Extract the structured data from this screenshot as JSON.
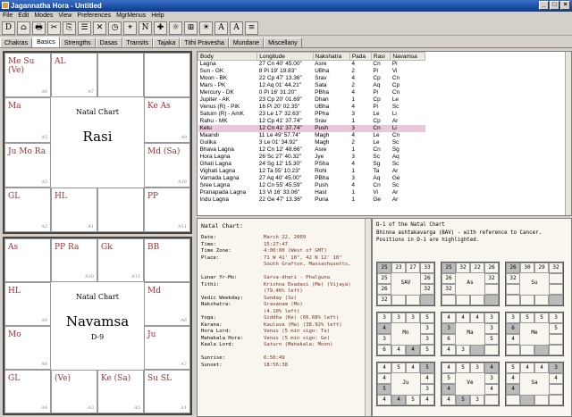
{
  "window": {
    "title": "Jagannatha Hora - Untitled",
    "buttons": [
      "_",
      "□",
      "×"
    ]
  },
  "menu": [
    "File",
    "Edit",
    "Modes",
    "View",
    "Preferences",
    "MgrMenus",
    "Help"
  ],
  "toolbar": [
    "D",
    "⌂",
    "🖶",
    "✂",
    "⎘",
    "☰",
    "✕",
    "◷",
    "⌖",
    "N",
    "✚",
    "☼",
    "⊞",
    "☀",
    "A",
    "A",
    "≡"
  ],
  "tabs": [
    "Chakras",
    "Basics",
    "Strengths",
    "Dasas",
    "Transits",
    "Tajaka",
    "Tithi Pravesha",
    "Mundane",
    "Miscellany"
  ],
  "active_tab": "Basics",
  "rasi": {
    "title": "Natal Chart",
    "name": "Rasi",
    "cells": [
      {
        "p": "Me  Su  (Ve)",
        "s": "A6"
      },
      {
        "p": "AL",
        "s": "A7"
      },
      {
        "p": "",
        "s": ""
      },
      {
        "p": "",
        "s": ""
      },
      {
        "p": "Ma",
        "s": "A5"
      },
      {
        "p": "Ke  As",
        "s": "A9"
      },
      {
        "p": "Ju  Mo  Ra",
        "s": "A3"
      },
      {
        "p": "Md  (Sa)",
        "s": "A10"
      },
      {
        "p": "GL",
        "s": "A2"
      },
      {
        "p": "HL",
        "s": "A1"
      },
      {
        "p": "",
        "s": ""
      },
      {
        "p": "PP",
        "s": "A11"
      }
    ]
  },
  "navamsa": {
    "title": "Natal Chart",
    "name": "Navamsa",
    "sub": "D-9",
    "cells": [
      {
        "p": "As",
        "s": ""
      },
      {
        "p": "PP  Ra",
        "s": "A10"
      },
      {
        "p": "Gk",
        "s": "A11"
      },
      {
        "p": "BB",
        "s": ""
      },
      {
        "p": "HL",
        "s": "A9"
      },
      {
        "p": "Md",
        "s": "A6"
      },
      {
        "p": "Mo",
        "s": "A8"
      },
      {
        "p": "Ju",
        "s": "A7"
      },
      {
        "p": "GL",
        "s": "A4"
      },
      {
        "p": "(Ve)",
        "s": "A3"
      },
      {
        "p": "Ke  (Sa)",
        "s": "A5"
      },
      {
        "p": "Su  SL",
        "s": "A1"
      }
    ]
  },
  "planets": {
    "headers": [
      "Body",
      "Longitude",
      "Nakshatra",
      "Pada",
      "Rasi",
      "Navamsa"
    ],
    "rows": [
      [
        "Lagna",
        "27 Cn 40' 45.00\"",
        "Asre",
        "4",
        "Cn",
        "Pi"
      ],
      [
        "Sun - GK",
        "8 Pi 19' 19.83\"",
        "UBha",
        "2",
        "Pi",
        "Vi"
      ],
      [
        "Moon - BK",
        "22 Cp 47' 13.36\"",
        "Srav",
        "4",
        "Cp",
        "Cn"
      ],
      [
        "Mars - PK",
        "12 Aq 01' 44.21\"",
        "Sata",
        "2",
        "Aq",
        "Cp"
      ],
      [
        "Mercury - DK",
        "0 Pi 16' 31.20\"",
        "PBha",
        "4",
        "Pi",
        "Cn"
      ],
      [
        "Jupiter - AK",
        "23 Cp 20' 01.69\"",
        "Dhan",
        "1",
        "Cp",
        "Le"
      ],
      [
        "Venus (R) - PiK",
        "16 Pi 20' 02.35\"",
        "UBha",
        "4",
        "Pi",
        "Sc"
      ],
      [
        "Saturn (R) - AmK",
        "23 Le 17' 32.63\"",
        "PPha",
        "3",
        "Le",
        "Li"
      ],
      [
        "Rahu - MK",
        "12 Cp 41' 37.74\"",
        "Srav",
        "1",
        "Cp",
        "Ar"
      ],
      [
        "Ketu",
        "12 Cn 41' 37.74\"",
        "Push",
        "3",
        "Cn",
        "Li"
      ],
      [
        "Maandi",
        "11 Le 49' 57.74\"",
        "Magh",
        "4",
        "Le",
        "Cn"
      ],
      [
        "Gulika",
        "3 Le 01' 34.92\"",
        "Magh",
        "2",
        "Le",
        "Sc"
      ],
      [
        "Bhava Lagna",
        "12 Cn 12' 48.66\"",
        "Asre",
        "1",
        "Cn",
        "Sg"
      ],
      [
        "Hora Lagna",
        "26 Sc 27' 40.32\"",
        "Jye",
        "3",
        "Sc",
        "Aq"
      ],
      [
        "Ghati Lagna",
        "24 Sg 12' 15.30\"",
        "PSha",
        "4",
        "Sg",
        "Sc"
      ],
      [
        "Vighati Lagna",
        "12 Ta 55' 10.23\"",
        "Rohi",
        "1",
        "Ta",
        "Ar"
      ],
      [
        "Varnada Lagna",
        "27 Aq 40' 45.00\"",
        "PBha",
        "3",
        "Aq",
        "Ge"
      ],
      [
        "Sree Lagna",
        "12 Cn 55' 45.59\"",
        "Push",
        "4",
        "Cn",
        "Sc"
      ],
      [
        "Pranapada Lagna",
        "13 Vi 16' 33.06\"",
        "Hast",
        "1",
        "Vi",
        "Ar"
      ],
      [
        "Indu Lagna",
        "22 Ge 47' 13.36\"",
        "Puna",
        "1",
        "Ge",
        "Ar"
      ]
    ],
    "selected": 9
  },
  "info": {
    "heading": "Natal Chart:",
    "rows": [
      [
        "Date:",
        "March 22, 2009"
      ],
      [
        "Time:",
        "15:27:47"
      ],
      [
        "Time Zone:",
        "4:00:00 (West of GMT)"
      ],
      [
        "Place:",
        "71 W 41' 10\", 42 N 12' 10\""
      ],
      [
        "",
        "South Grafton, Massachusetts,"
      ],
      [
        "",
        ""
      ],
      [
        "Lunar Yr-Mo:",
        "Sarva-dhari - Phalguna"
      ],
      [
        "Tithi:",
        "Krishna Dvadasi (Me) (Vijaya)"
      ],
      [
        "",
        "(79.46% left)"
      ],
      [
        "Vedic Weekday:",
        "Sunday (Su)"
      ],
      [
        "Nakshatra:",
        "Sravanam (Mo)"
      ],
      [
        "",
        "(4.10% left)"
      ],
      [
        "Yoga:",
        "Siddha (Ke) (66.68% left)"
      ],
      [
        "Karana:",
        "Kaulava (Ma) (38.92% left)"
      ],
      [
        "Hora Lord:",
        "Venus (5 min sign: Ta)"
      ],
      [
        "Mahakala Hora:",
        "Venus (5 min sign: Ge)"
      ],
      [
        "Kaala Lord:",
        "Saturn (Mahakala: Moon)"
      ],
      [
        "",
        ""
      ],
      [
        "Sunrise:",
        "6:50:49"
      ],
      [
        "Sunset:",
        "18:56:38"
      ]
    ]
  },
  "bav": {
    "heading": "D-1 of the Natal Chart",
    "desc": "Bhinna ashtakavarga (BAV) - with reference to Cancer. Positions in D-1 are highlighted.",
    "charts": [
      {
        "labels": [
          "SAV",
          "As",
          "Su"
        ],
        "cells": [
          "25",
          "23",
          "27",
          "33",
          "25",
          "32",
          "22",
          "26",
          "26",
          "30",
          "29",
          "32",
          "32",
          "",
          "",
          "",
          "",
          "",
          "",
          "",
          "",
          "",
          "",
          "",
          "",
          "",
          "",
          "",
          ""
        ]
      },
      {
        "labels": [
          "Mo",
          "Ma",
          "Me"
        ],
        "cells": [
          "3",
          "3",
          "3",
          "5",
          "4",
          "4",
          "4",
          "3",
          "3",
          "5",
          "5",
          "3",
          "6",
          "4",
          "4",
          "5",
          "4",
          "3",
          "",
          "",
          "",
          "",
          "",
          "",
          "",
          "",
          "",
          "",
          ""
        ]
      },
      {
        "labels": [
          "Ju",
          "Ve",
          "Sa"
        ],
        "cells": [
          "4",
          "5",
          "4",
          "5",
          "4",
          "5",
          "3",
          "4",
          "5",
          "4",
          "4",
          "3",
          "4",
          "4",
          "5",
          "4",
          "4",
          "5",
          "3",
          "",
          "",
          "",
          "",
          "",
          "",
          "",
          "",
          "",
          ""
        ]
      }
    ]
  }
}
